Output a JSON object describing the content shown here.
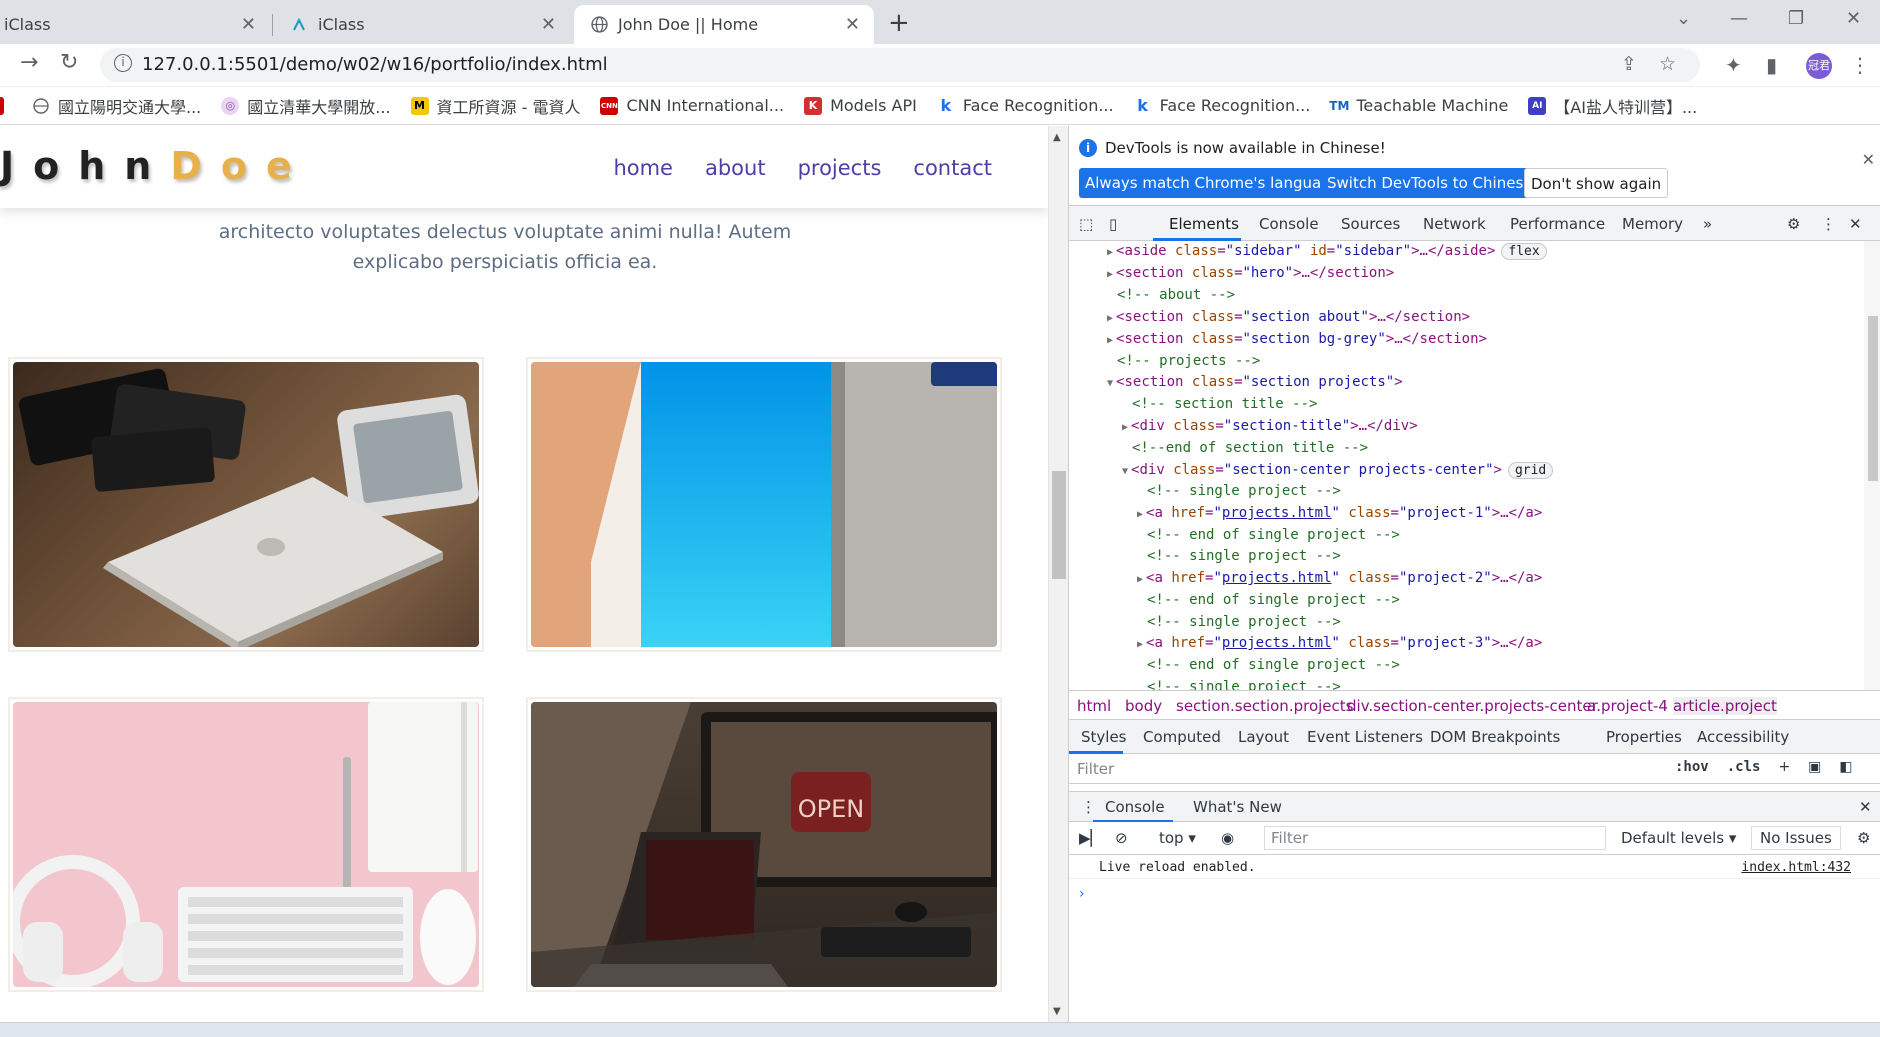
{
  "browser": {
    "tabs": [
      {
        "title": "iClass",
        "active": false
      },
      {
        "title": "iClass",
        "active": false
      },
      {
        "title": "John Doe || Home",
        "active": true
      }
    ],
    "url": "127.0.0.1:5501/demo/w02/w16/portfolio/index.html",
    "profile_initials": "冠君",
    "bookmarks": [
      "國立陽明交通大學...",
      "國立清華大學開放...",
      "資工所資源 - 電資人",
      "CNN International...",
      "Models API",
      "Face Recognition...",
      "Face Recognition...",
      "Teachable Machine",
      "【AI盐人特训营】..."
    ]
  },
  "site": {
    "logo_first": "John",
    "logo_last": "Doe",
    "nav": [
      "home",
      "about",
      "projects",
      "contact"
    ],
    "intro_line1": "architecto voluptates delectus voluptate animi nulla! Autem",
    "intro_line2": "explicabo perspiciatis officia ea.",
    "projects": [
      {
        "image": "laptop-and-phones-on-desk"
      },
      {
        "image": "blue-tablet-screen"
      },
      {
        "image": "pink-desk-headphones-keyboard"
      },
      {
        "image": "dark-desk-computer-open-sign"
      }
    ]
  },
  "devtools": {
    "notice": "DevTools is now available in Chinese!",
    "btn_match": "Always match Chrome's language",
    "btn_switch": "Switch DevTools to Chinese",
    "btn_dismiss": "Don't show again",
    "tabs": [
      "Elements",
      "Console",
      "Sources",
      "Network",
      "Performance",
      "Memory"
    ],
    "breadcrumbs": [
      "html",
      "body",
      "section.section.projects",
      "div.section-center.projects-center",
      "a.project-4",
      "article.project"
    ],
    "subtabs": [
      "Styles",
      "Computed",
      "Layout",
      "Event Listeners",
      "DOM Breakpoints",
      "Properties",
      "Accessibility"
    ],
    "filter_placeholder": "Filter",
    "hov": ":hov",
    "cls": ".cls",
    "drawer_tabs": [
      "Console",
      "What's New"
    ],
    "console_context": "top",
    "console_filter": "Filter",
    "levels": "Default levels",
    "issues": "No Issues",
    "log_message": "Live reload enabled.",
    "log_source": "index.html:432",
    "badge_flex": "flex",
    "badge_grid": "grid"
  }
}
